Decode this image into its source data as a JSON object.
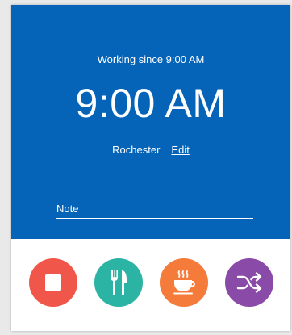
{
  "status": {
    "working_since": "Working since 9:00 AM",
    "time": "9:00 AM",
    "location": "Rochester",
    "edit_label": "Edit"
  },
  "note": {
    "placeholder": "Note",
    "value": ""
  },
  "actions": [
    {
      "name": "stop",
      "icon": "stop-icon",
      "color": "#f0564a"
    },
    {
      "name": "meal-break",
      "icon": "fork-knife-icon",
      "color": "#2bb3a3"
    },
    {
      "name": "coffee-break",
      "icon": "coffee-cup-icon",
      "color": "#f47b3a"
    },
    {
      "name": "switch",
      "icon": "shuffle-icon",
      "color": "#8a4aa8"
    }
  ],
  "colors": {
    "panel_background": "#0563b8",
    "text": "#ffffff"
  }
}
